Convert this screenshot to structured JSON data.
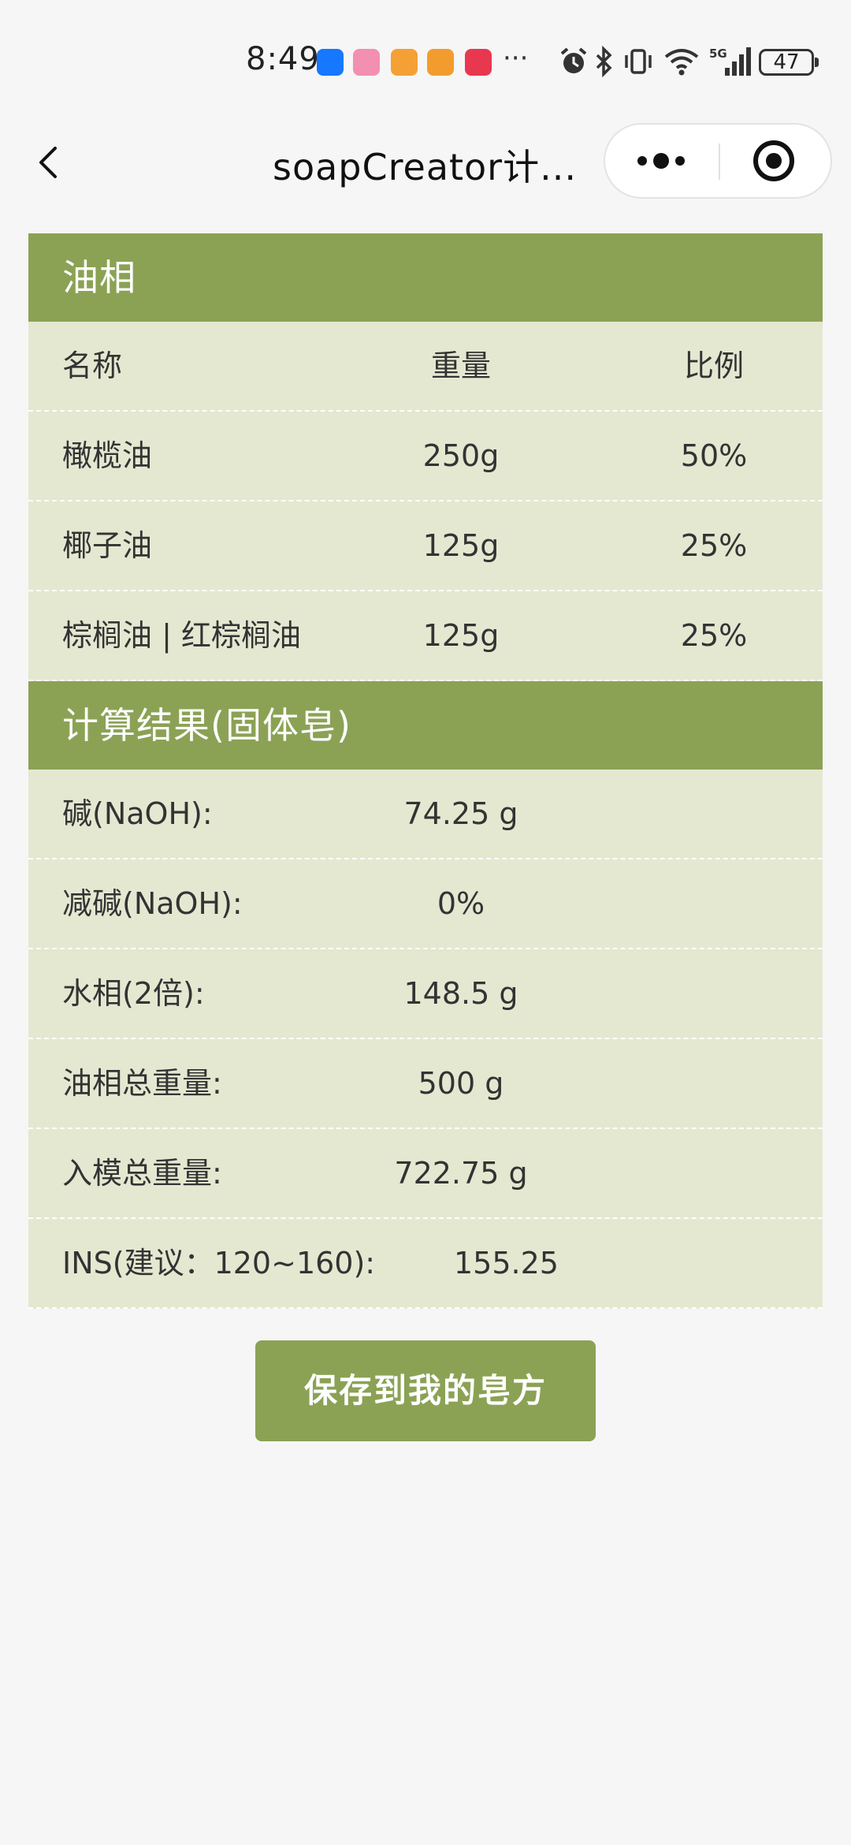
{
  "status_bar": {
    "time": "8:49",
    "more_indicator": "···",
    "battery": "47",
    "icons": [
      "alipay-icon",
      "bilibili-icon",
      "chat-app-icon",
      "health-app-icon",
      "mail-app-icon",
      "alarm-icon",
      "bluetooth-icon",
      "vibrate-icon",
      "wifi-icon",
      "5g-signal-icon"
    ]
  },
  "nav": {
    "title": "soapCreator计...",
    "back_icon": "chevron-left-icon",
    "more_icon": "more-dots-icon",
    "close_icon": "target-circle-icon"
  },
  "oil_phase": {
    "title": "油相",
    "headers": {
      "name": "名称",
      "weight": "重量",
      "ratio": "比例"
    },
    "rows": [
      {
        "name": "橄榄油",
        "weight": "250g",
        "ratio": "50%"
      },
      {
        "name": "椰子油",
        "weight": "125g",
        "ratio": "25%"
      },
      {
        "name": "棕榈油 | 红棕榈油",
        "weight": "125g",
        "ratio": "25%"
      }
    ]
  },
  "results": {
    "title": "计算结果(固体皂)",
    "rows": [
      {
        "label": "碱(NaOH):",
        "value": "74.25 g"
      },
      {
        "label": "减碱(NaOH):",
        "value": "0%"
      },
      {
        "label": "水相(2倍):",
        "value": "148.5 g"
      },
      {
        "label": "油相总重量:",
        "value": "500 g"
      },
      {
        "label": "入模总重量:",
        "value": "722.75 g"
      }
    ],
    "ins": {
      "label": "INS(建议：120~160):",
      "value": "155.25"
    }
  },
  "actions": {
    "save_label": "保存到我的皂方"
  },
  "colors": {
    "accent": "#8ba255",
    "row_bg": "#e4e8d1",
    "page_bg": "#f6f6f6"
  }
}
